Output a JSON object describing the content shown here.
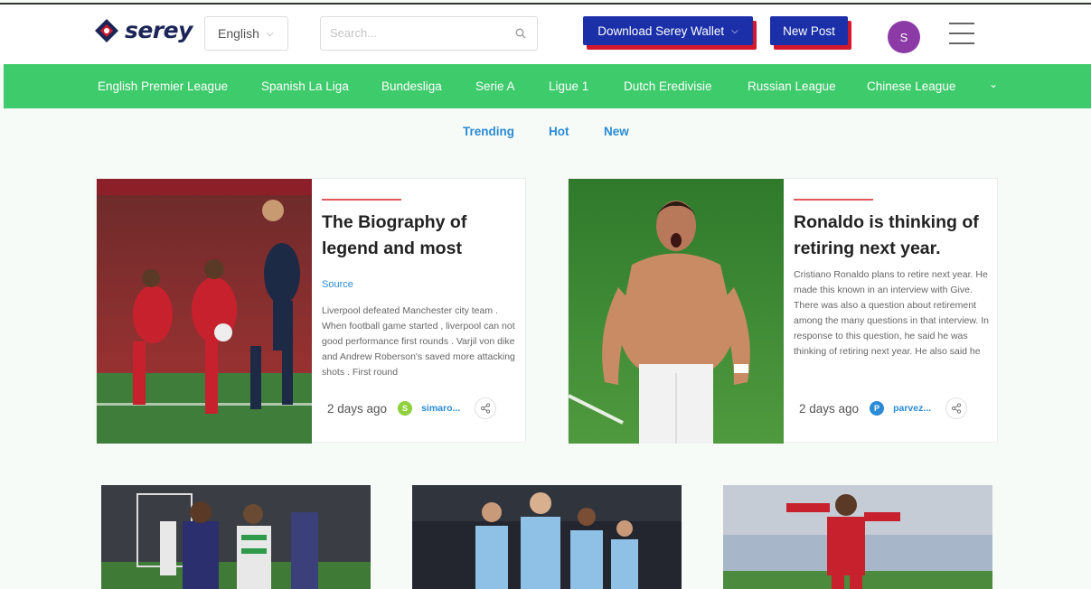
{
  "header": {
    "logo_text": "serey",
    "language": "English",
    "search_placeholder": "Search...",
    "wallet_button": "Download Serey Wallet",
    "new_post_button": "New Post",
    "avatar_initial": "S"
  },
  "nav": {
    "items": [
      "English Premier League",
      "Spanish La Liga",
      "Bundesliga",
      "Serie A",
      "Ligue 1",
      "Dutch Eredivisie",
      "Russian League",
      "Chinese League"
    ]
  },
  "tabs": [
    "Trending",
    "Hot",
    "New"
  ],
  "posts": [
    {
      "title": "The Biography of legend and most",
      "source": "Source",
      "excerpt": "Liverpool defeated Manchester city team . When football game started , liverpool can not good performance first rounds . Varjil von dike and Andrew Roberson's saved more attacking shots . First round",
      "time": "2 days ago",
      "author_initial": "S",
      "author": "simaro..."
    },
    {
      "title": "Ronaldo is thinking of retiring next year.",
      "excerpt": "Cristiano Ronaldo plans to retire next year. He made this known in an interview with Give. There was also a question about retirement among the many questions in that interview. In response to this question, he said he was thinking of retiring next year. He also said he",
      "time": "2 days ago",
      "author_initial": "P",
      "author": "parvez..."
    }
  ],
  "colors": {
    "brand_blue": "#1a2fa8",
    "accent_red": "#d4182b",
    "nav_green": "#3ecb6b",
    "link_blue": "#2a8bd6"
  }
}
